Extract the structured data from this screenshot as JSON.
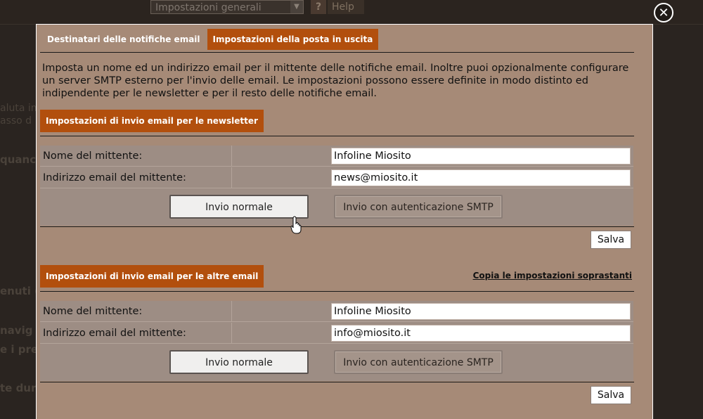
{
  "background": {
    "select_value": "Impostazioni generali",
    "help_label": "Help",
    "fragments": [
      "aluta im",
      "asso d",
      "quanc",
      "enuti (",
      "navig",
      "e i prez",
      "te dura"
    ]
  },
  "close_icon": "close-icon",
  "tabs": [
    {
      "label": "Destinatari delle notifiche email",
      "active": false
    },
    {
      "label": "Impostazioni della posta in uscita",
      "active": true
    }
  ],
  "intro_text": "Imposta un nome ed un indirizzo email per il mittente delle notifiche email. Inoltre puoi opzionalmente configurare un server SMTP esterno per l'invio delle email. Le impostazioni possono essere definite in modo distinto ed indipendente per le newsletter e per il resto delle notifiche email.",
  "newsletter": {
    "header": "Impostazioni di invio email per le newsletter",
    "sender_name_label": "Nome del mittente:",
    "sender_name_value": "Infoline Miosito",
    "sender_email_label": "Indirizzo email del mittente:",
    "sender_email_value": "news@miosito.it",
    "normal_button": "Invio normale",
    "smtp_button": "Invio con autenticazione SMTP",
    "save_button": "Salva"
  },
  "other": {
    "header": "Impostazioni di invio email per le altre email",
    "copy_link": "Copia le impostazioni soprastanti",
    "sender_name_label": "Nome del mittente:",
    "sender_name_value": "Infoline Miosito",
    "sender_email_label": "Indirizzo email del mittente:",
    "sender_email_value": "info@miosito.it",
    "normal_button": "Invio normale",
    "smtp_button": "Invio con autenticazione SMTP",
    "save_button": "Salva"
  },
  "colors": {
    "accent": "#b24f0d",
    "modal_bg": "#a68a77",
    "form_bg": "#9d8d84"
  }
}
